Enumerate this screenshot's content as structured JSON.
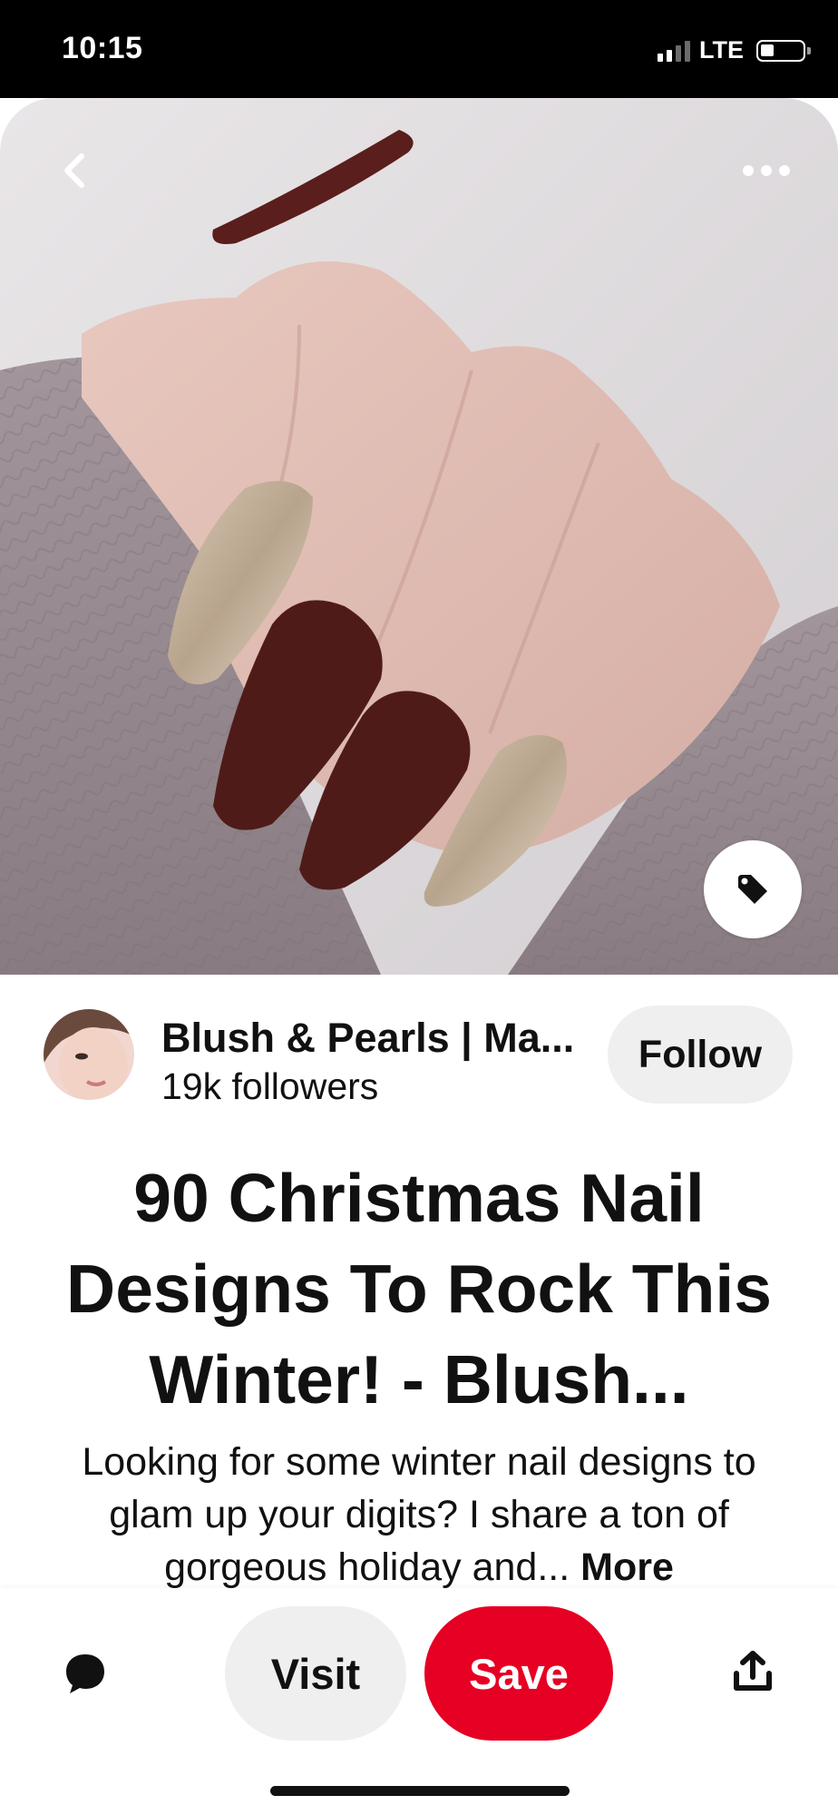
{
  "status_bar": {
    "time": "10:15",
    "network": "LTE",
    "signal_bars_active": 2,
    "signal_bars_total": 4
  },
  "hero": {
    "back_icon": "chevron-left-icon",
    "more_icon": "ellipsis-icon",
    "tag_icon": "price-tag-icon"
  },
  "creator": {
    "name": "Blush & Pearls | Ma...",
    "followers": "19k followers",
    "follow_label": "Follow"
  },
  "pin": {
    "title": "90 Christmas Nail Designs To Rock This Winter! - Blush...",
    "description": "Looking for some winter nail designs to glam up your digits? I share a ton of gorgeous holiday and...",
    "more_label": "More"
  },
  "actions": {
    "comment_icon": "comment-bubble-icon",
    "visit_label": "Visit",
    "save_label": "Save",
    "share_icon": "share-upload-icon"
  },
  "colors": {
    "save_red": "#e60023",
    "button_gray": "#efefef",
    "text": "#111111"
  }
}
